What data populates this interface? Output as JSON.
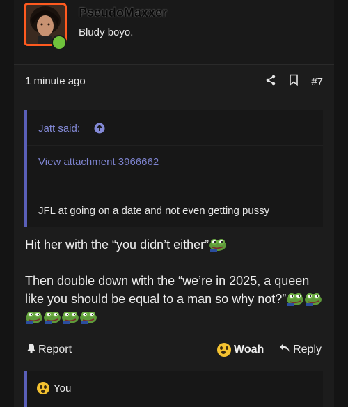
{
  "post": {
    "username": "PseudoMaxxer",
    "user_title": "Bludy boyo.",
    "timestamp": "1 minute ago",
    "post_number": "#7",
    "quote": {
      "author": "Jatt said:",
      "attachment_link": "View attachment 3966662",
      "text": "JFL at going on a date and not even getting pussy"
    },
    "body_line1": "Hit her with the “you didn’t either”",
    "body_line2": "Then double down with the “we’re in 2025, a queen like you should be equal to a man so why not?”",
    "actions": {
      "report": "Report",
      "reaction": "Woah",
      "reply": "Reply"
    },
    "reactions_bar": {
      "label": "You"
    }
  },
  "colors": {
    "accent": "#5a5fb8",
    "link": "#7d83cf",
    "avatar_border": "#ff5a1f",
    "online": "#6fc23c"
  },
  "icons": [
    "share-icon",
    "bookmark-icon",
    "arrow-up-circle-icon",
    "bell-icon",
    "shocked-face-icon",
    "reply-arrow-icon",
    "pepe-frog-emoji"
  ]
}
